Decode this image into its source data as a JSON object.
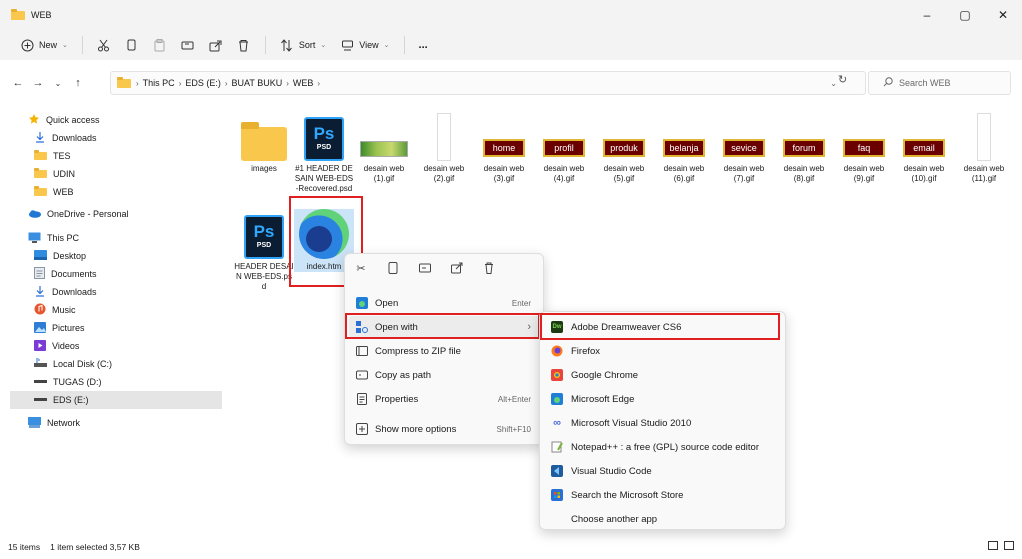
{
  "window": {
    "title": "WEB",
    "minimize": "–",
    "maximize": "▢",
    "close": "✕"
  },
  "commandbar": {
    "new_label": "New",
    "sort_label": "Sort",
    "view_label": "View",
    "more_label": "..."
  },
  "address": {
    "crumbs": [
      "This PC",
      "EDS (E:)",
      "BUAT BUKU",
      "WEB"
    ],
    "search_placeholder": "Search WEB"
  },
  "sidebar": {
    "items": [
      {
        "label": "Quick access",
        "icon": "star-icon"
      },
      {
        "label": "Downloads",
        "icon": "download-icon"
      },
      {
        "label": "TES",
        "icon": "folder-icon"
      },
      {
        "label": "UDIN",
        "icon": "folder-icon"
      },
      {
        "label": "WEB",
        "icon": "folder-icon"
      },
      {
        "label": "OneDrive - Personal",
        "icon": "cloud-icon"
      },
      {
        "label": "This PC",
        "icon": "monitor-icon"
      },
      {
        "label": "Desktop",
        "icon": "desktop-icon"
      },
      {
        "label": "Documents",
        "icon": "document-icon"
      },
      {
        "label": "Downloads",
        "icon": "download-icon"
      },
      {
        "label": "Music",
        "icon": "music-icon"
      },
      {
        "label": "Pictures",
        "icon": "pictures-icon"
      },
      {
        "label": "Videos",
        "icon": "video-icon"
      },
      {
        "label": "Local Disk (C:)",
        "icon": "drive-icon"
      },
      {
        "label": "TUGAS (D:)",
        "icon": "drive-icon"
      },
      {
        "label": "EDS (E:)",
        "icon": "drive-icon"
      },
      {
        "label": "Network",
        "icon": "network-icon"
      }
    ]
  },
  "files": {
    "row1": [
      {
        "name": "images",
        "kind": "folder"
      },
      {
        "name": "#1 HEADER DESAIN WEB-EDS-Recovered.psd",
        "kind": "psd"
      },
      {
        "name": "desain web (1).gif",
        "kind": "mini"
      },
      {
        "name": "desain web (2).gif",
        "kind": "blank"
      },
      {
        "name": "desain web (3).gif",
        "kind": "btn",
        "btn": "home"
      },
      {
        "name": "desain web (4).gif",
        "kind": "btn",
        "btn": "profil"
      },
      {
        "name": "desain web (5).gif",
        "kind": "btn",
        "btn": "produk"
      },
      {
        "name": "desain web (6).gif",
        "kind": "btn",
        "btn": "belanja"
      },
      {
        "name": "desain web (7).gif",
        "kind": "btn",
        "btn": "sevice"
      },
      {
        "name": "desain web (8).gif",
        "kind": "btn",
        "btn": "forum"
      },
      {
        "name": "desain web (9).gif",
        "kind": "btn",
        "btn": "faq"
      },
      {
        "name": "desain web (10).gif",
        "kind": "btn",
        "btn": "email"
      },
      {
        "name": "desain web (11).gif",
        "kind": "blank"
      }
    ],
    "row2": [
      {
        "name": "HEADER DESAIN WEB-EDS.psd",
        "kind": "psd"
      },
      {
        "name": "index.htm",
        "kind": "edge"
      }
    ],
    "psd_big": "Ps",
    "psd_small": "PSD"
  },
  "context_menu": {
    "items": [
      {
        "label": "Open",
        "hint": "Enter"
      },
      {
        "label": "Open with",
        "hint": "›"
      },
      {
        "label": "Compress to ZIP file",
        "hint": ""
      },
      {
        "label": "Copy as path",
        "hint": ""
      },
      {
        "label": "Properties",
        "hint": "Alt+Enter"
      },
      {
        "label": "Show more options",
        "hint": "Shift+F10"
      }
    ]
  },
  "open_with": {
    "items": [
      {
        "label": "Adobe Dreamweaver CS6",
        "color": "#1b3a12",
        "glyph": "Dw"
      },
      {
        "label": "Firefox",
        "color": "#ff7a1a",
        "glyph": ""
      },
      {
        "label": "Google Chrome",
        "color": "#e8453c",
        "glyph": ""
      },
      {
        "label": "Microsoft Edge",
        "color": "#1f7fd8",
        "glyph": ""
      },
      {
        "label": "Microsoft Visual Studio 2010",
        "color": "#68217a",
        "glyph": "∞"
      },
      {
        "label": "Notepad++ : a free (GPL) source code editor",
        "color": "#9bcf4a",
        "glyph": ""
      },
      {
        "label": "Visual Studio Code",
        "color": "#1f5c9e",
        "glyph": ""
      },
      {
        "label": "Search the Microsoft Store",
        "color": "#2a6fd6",
        "glyph": ""
      },
      {
        "label": "Choose another app",
        "color": "",
        "glyph": ""
      }
    ]
  },
  "status": {
    "count": "15 items",
    "selection": "1 item selected  3,57 KB"
  }
}
